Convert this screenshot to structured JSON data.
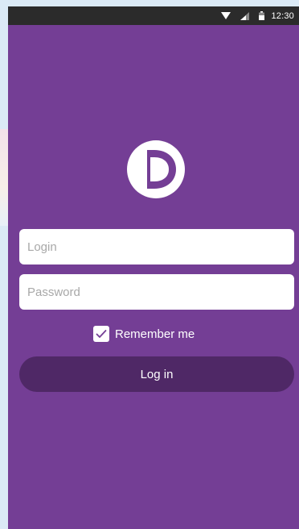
{
  "status_bar": {
    "time": "12:30",
    "icons": [
      "wifi-icon",
      "signal-icon",
      "battery-icon"
    ]
  },
  "logo": {
    "icon": "d-logo-icon",
    "letter": "D"
  },
  "form": {
    "login_placeholder": "Login",
    "login_value": "",
    "password_placeholder": "Password",
    "password_value": "",
    "remember_label": "Remember me",
    "remember_checked": true,
    "login_button_label": "Log in"
  },
  "colors": {
    "background": "#743e95",
    "button": "#4f2866",
    "status_bar": "#2b2b2b",
    "field": "#ffffff"
  }
}
